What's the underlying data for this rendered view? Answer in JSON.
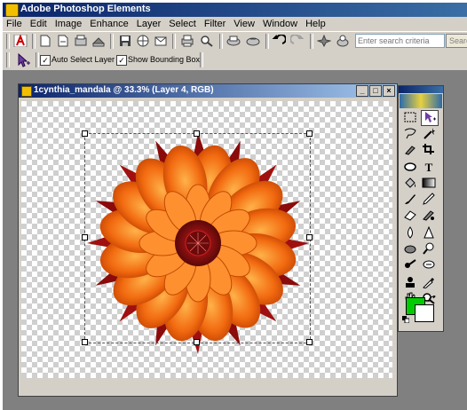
{
  "app": {
    "title": "Adobe Photoshop Elements"
  },
  "menu": [
    "File",
    "Edit",
    "Image",
    "Enhance",
    "Layer",
    "Select",
    "Filter",
    "View",
    "Window",
    "Help"
  ],
  "shortcuts": {
    "search_placeholder": "Enter search criteria",
    "search_button": "Search"
  },
  "options": {
    "auto_select_label": "Auto Select Layer",
    "show_bounding_label": "Show Bounding Box",
    "auto_select_checked": "✓",
    "show_bounding_checked": "✓"
  },
  "document": {
    "title": "1cynthia_mandala @ 33.3% (Layer 4, RGB)",
    "min_label": "_",
    "max_label": "□",
    "close_label": "×"
  },
  "toolbox": {
    "foreground_color": "#00cc00",
    "background_color": "#ffffff"
  }
}
